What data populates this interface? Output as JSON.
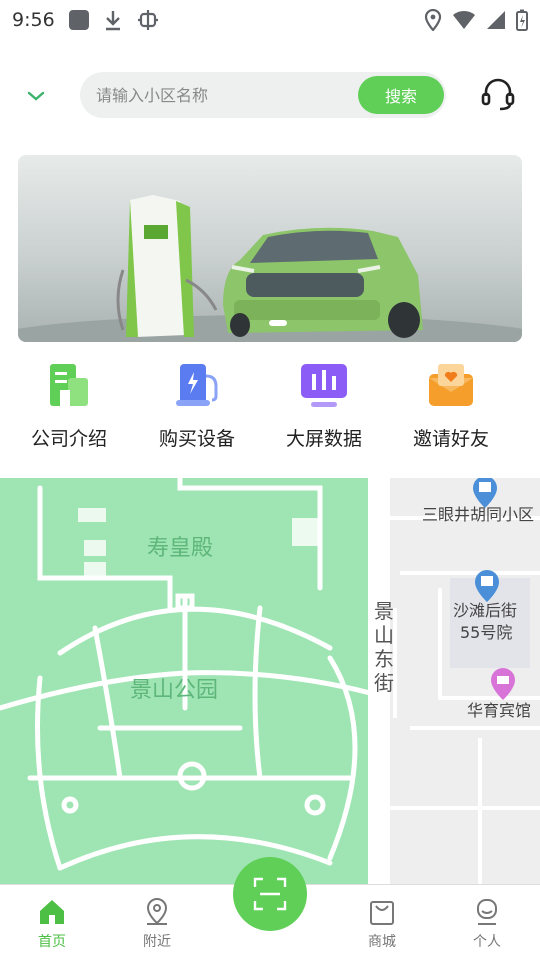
{
  "status_bar": {
    "time": "9:56",
    "icons": [
      "app-icon",
      "download-icon",
      "bug-icon",
      "location-icon",
      "wifi-icon",
      "signal-icon",
      "battery-icon"
    ]
  },
  "header": {
    "dropdown_icon": "chevron-down-icon",
    "search_placeholder": "请输入小区名称",
    "search_button": "搜索",
    "service_icon": "headset-icon"
  },
  "banner": {
    "slide_count": 1,
    "active_slide": 1
  },
  "quick_menu": [
    {
      "label": "公司介绍",
      "icon": "building-icon",
      "color": "#5fcf57"
    },
    {
      "label": "购买设备",
      "icon": "charger-icon",
      "color": "#5b7cf0"
    },
    {
      "label": "大屏数据",
      "icon": "dashboard-icon",
      "color": "#8b5cf6"
    },
    {
      "label": "邀请好友",
      "icon": "invite-icon",
      "color": "#f59e2b"
    }
  ],
  "map": {
    "labels": {
      "shouhuangdian": "寿皇殿",
      "jingshan_park": "景山公园",
      "jingshan_east_street": [
        "景",
        "山",
        "东",
        "街"
      ],
      "sanyanjing": "三眼井胡同小区",
      "shatanhoujie": [
        "沙滩后街",
        "55号院"
      ],
      "huayu_hotel": "华育宾馆"
    }
  },
  "bottom_nav": {
    "items": [
      {
        "label": "首页",
        "icon": "home-icon",
        "active": true
      },
      {
        "label": "附近",
        "icon": "location-pin-icon",
        "active": false
      },
      {
        "label": "商城",
        "icon": "shop-icon",
        "active": false
      },
      {
        "label": "个人",
        "icon": "user-icon",
        "active": false
      }
    ],
    "scan_icon": "scan-icon"
  },
  "colors": {
    "accent": "#5fcf57",
    "park_green": "#9ee5b3"
  }
}
